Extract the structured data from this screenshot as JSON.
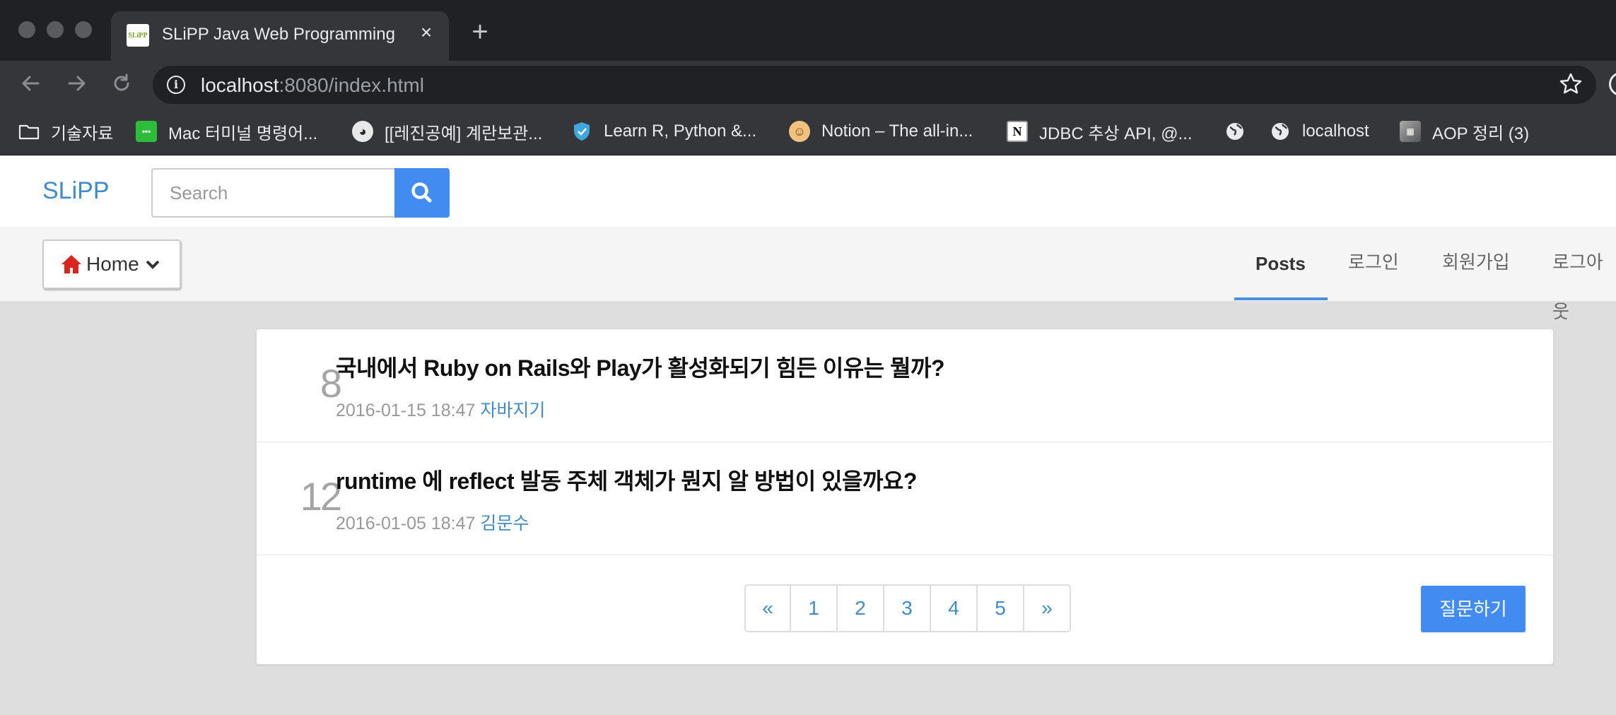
{
  "browser": {
    "tab_title": "SLiPP Java Web Programming",
    "tab_favicon_text": "SLiPP",
    "tab_close": "×",
    "new_tab": "+",
    "url_host": "localhost",
    "url_rest": ":8080/index.html"
  },
  "bookmarks": [
    {
      "label": "기술자료",
      "icon": "folder-icon"
    },
    {
      "label": "Mac 터미널 명령어...",
      "icon": "chat-icon"
    },
    {
      "label": "[[레진공예] 계란보관...",
      "icon": "raccoon-icon"
    },
    {
      "label": "Learn R, Python &...",
      "icon": "shield-icon"
    },
    {
      "label": "Notion – The all-in...",
      "icon": "person-icon"
    },
    {
      "label": "JDBC 추상 API, @...",
      "icon": "notion-icon"
    },
    {
      "label": "",
      "icon": "globe-icon"
    },
    {
      "label": "localhost",
      "icon": "globe-icon"
    },
    {
      "label": "AOP 정리 (3)",
      "icon": "image-icon"
    }
  ],
  "site": {
    "brand": "SLiPP",
    "search_placeholder": "Search",
    "home_label": "Home",
    "nav": [
      "Posts",
      "로그인",
      "회원가입",
      "로그아웃"
    ],
    "active_nav": "Posts"
  },
  "posts": [
    {
      "count": "8",
      "title": "국내에서 Ruby on Rails와 Play가 활성화되기 힘든 이유는 뭘까?",
      "date": "2016-01-15 18:47",
      "author": "자바지기"
    },
    {
      "count": "12",
      "title": "runtime 에 reflect 발동 주체 객체가 뭔지 알 방법이 있을까요?",
      "date": "2016-01-05 18:47",
      "author": "김문수"
    }
  ],
  "pagination": [
    "«",
    "1",
    "2",
    "3",
    "4",
    "5",
    "»"
  ],
  "ask_button": "질문하기",
  "colors": {
    "primary": "#428bf0",
    "link": "#428bca",
    "home_icon": "#d9251d"
  }
}
